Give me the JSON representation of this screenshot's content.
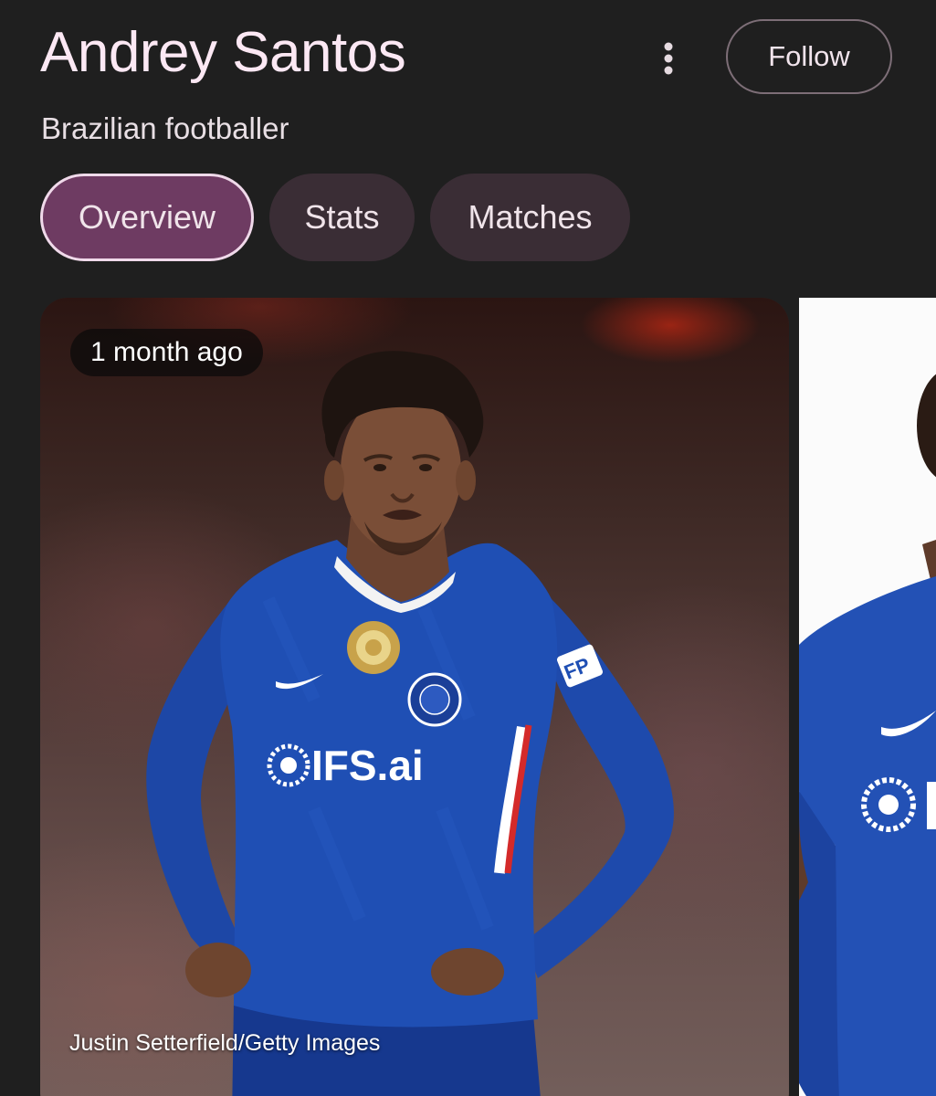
{
  "header": {
    "title": "Andrey Santos",
    "subtitle": "Brazilian footballer",
    "more_icon": "more-vertical-icon",
    "follow_label": "Follow"
  },
  "tabs": [
    {
      "label": "Overview",
      "active": true
    },
    {
      "label": "Stats",
      "active": false
    },
    {
      "label": "Matches",
      "active": false
    }
  ],
  "cards": [
    {
      "time": "1 month ago",
      "credit": "Justin Setterfield/Getty Images",
      "sponsor_text": "IFS.ai"
    }
  ],
  "colors": {
    "background": "#1f1f1f",
    "title": "#fce8f4",
    "chip": "#3a2d35",
    "chip_active": "#6e3b62",
    "jersey_blue": "#1f4fb4"
  }
}
